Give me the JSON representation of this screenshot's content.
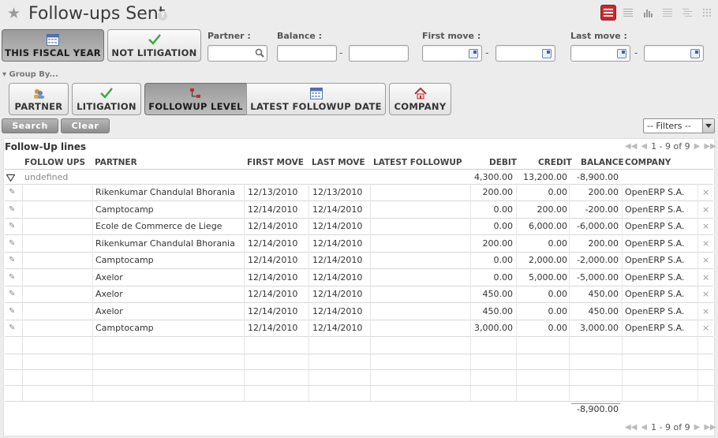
{
  "header": {
    "title": "Follow-ups Sent",
    "help": "?"
  },
  "view_switch": [
    "list-view-icon",
    "form-view-icon",
    "graph-view-icon",
    "calendar-view-icon",
    "gantt-view-icon",
    "kanban-view-icon"
  ],
  "filters": {
    "this_fiscal_year": "THIS FISCAL YEAR",
    "not_litigation": "NOT LITIGATION",
    "partner_label": "Partner :",
    "balance_label": "Balance :",
    "first_move_label": "First move :",
    "last_move_label": "Last move :",
    "dash": "-"
  },
  "group_by": {
    "label": "▾ Group By...",
    "partner": "PARTNER",
    "litigation": "LITIGATION",
    "followup_level": "FOLLOWUP LEVEL",
    "latest_followup_date": "LATEST FOLLOWUP DATE",
    "company": "COMPANY"
  },
  "actions": {
    "search": "Search",
    "clear": "Clear",
    "filters": "-- Filters --"
  },
  "grid": {
    "title": "Follow-Up lines",
    "pager": "1 - 9 of 9",
    "columns": {
      "follow_ups": "FOLLOW UPS",
      "partner": "PARTNER",
      "first_move": "FIRST MOVE",
      "last_move": "LAST MOVE",
      "latest_followup": "LATEST FOLLOWUP",
      "debit": "DEBIT",
      "credit": "CREDIT",
      "balance": "BALANCE",
      "company": "COMPANY"
    },
    "group": {
      "label": "undefined",
      "debit": "4,300.00",
      "credit": "13,200.00",
      "balance": "-8,900.00"
    },
    "rows": [
      {
        "partner": "Rikenkumar Chandulal Bhorania",
        "first_move": "12/13/2010",
        "last_move": "12/13/2010",
        "debit": "200.00",
        "credit": "0.00",
        "balance": "200.00",
        "company": "OpenERP S.A."
      },
      {
        "partner": "Camptocamp",
        "first_move": "12/14/2010",
        "last_move": "12/14/2010",
        "debit": "0.00",
        "credit": "200.00",
        "balance": "-200.00",
        "company": "OpenERP S.A."
      },
      {
        "partner": "Ecole de Commerce de Liege",
        "first_move": "12/14/2010",
        "last_move": "12/14/2010",
        "debit": "0.00",
        "credit": "6,000.00",
        "balance": "-6,000.00",
        "company": "OpenERP S.A."
      },
      {
        "partner": "Rikenkumar Chandulal Bhorania",
        "first_move": "12/14/2010",
        "last_move": "12/14/2010",
        "debit": "200.00",
        "credit": "0.00",
        "balance": "200.00",
        "company": "OpenERP S.A."
      },
      {
        "partner": "Camptocamp",
        "first_move": "12/14/2010",
        "last_move": "12/14/2010",
        "debit": "0.00",
        "credit": "2,000.00",
        "balance": "-2,000.00",
        "company": "OpenERP S.A."
      },
      {
        "partner": "Axelor",
        "first_move": "12/14/2010",
        "last_move": "12/14/2010",
        "debit": "0.00",
        "credit": "5,000.00",
        "balance": "-5,000.00",
        "company": "OpenERP S.A."
      },
      {
        "partner": "Axelor",
        "first_move": "12/14/2010",
        "last_move": "12/14/2010",
        "debit": "450.00",
        "credit": "0.00",
        "balance": "450.00",
        "company": "OpenERP S.A."
      },
      {
        "partner": "Axelor",
        "first_move": "12/14/2010",
        "last_move": "12/14/2010",
        "debit": "450.00",
        "credit": "0.00",
        "balance": "450.00",
        "company": "OpenERP S.A."
      },
      {
        "partner": "Camptocamp",
        "first_move": "12/14/2010",
        "last_move": "12/14/2010",
        "debit": "3,000.00",
        "credit": "0.00",
        "balance": "3,000.00",
        "company": "OpenERP S.A."
      }
    ],
    "total_balance": "-8,900.00",
    "row_edit_icon": "pencil-icon",
    "row_delete_icon": "close-icon",
    "delete_glyph": "×"
  },
  "colors": {
    "accent": "#c7292e",
    "pressed": "#a8a8a8",
    "check": "#3aa845"
  }
}
